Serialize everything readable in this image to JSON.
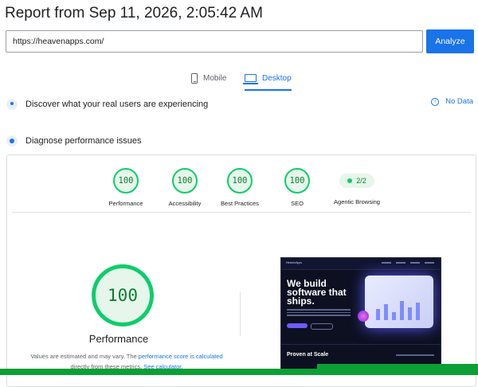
{
  "report": {
    "title": "Report from Sep 11, 2026, 2:05:42 AM"
  },
  "search": {
    "url": "https://heavenapps.com/",
    "analyze_label": "Analyze"
  },
  "tabs": [
    {
      "label": "Mobile",
      "icon": "phone-icon",
      "active": false
    },
    {
      "label": "Desktop",
      "icon": "monitor-icon",
      "active": true
    }
  ],
  "real_users": {
    "heading": "Discover what your real users are experiencing",
    "status": "No Data",
    "status_icon": "info-icon"
  },
  "diagnose": {
    "heading": "Diagnose performance issues"
  },
  "scores": [
    {
      "label": "Performance",
      "value": "100"
    },
    {
      "label": "Accessibility",
      "value": "100"
    },
    {
      "label": "Best Practices",
      "value": "100"
    },
    {
      "label": "SEO",
      "value": "100"
    }
  ],
  "agentic": {
    "label": "Agentic Browsing",
    "value": "2/2"
  },
  "performance": {
    "score": "100",
    "label": "Performance",
    "note_prefix": "Values are estimated and may vary. The ",
    "note_link1": "performance score is calculated",
    "note_mid": " directly from these metrics. ",
    "note_link2": "See calculator."
  },
  "screenshot": {
    "headline": "We build software that ships.",
    "section_title": "Proven at Scale",
    "brand": "HeavenApps"
  },
  "colors": {
    "accent": "#1a73e8",
    "pass_green": "#0cce6b",
    "pass_bg": "#e6f6ea",
    "pass_text": "#0a7d32"
  }
}
